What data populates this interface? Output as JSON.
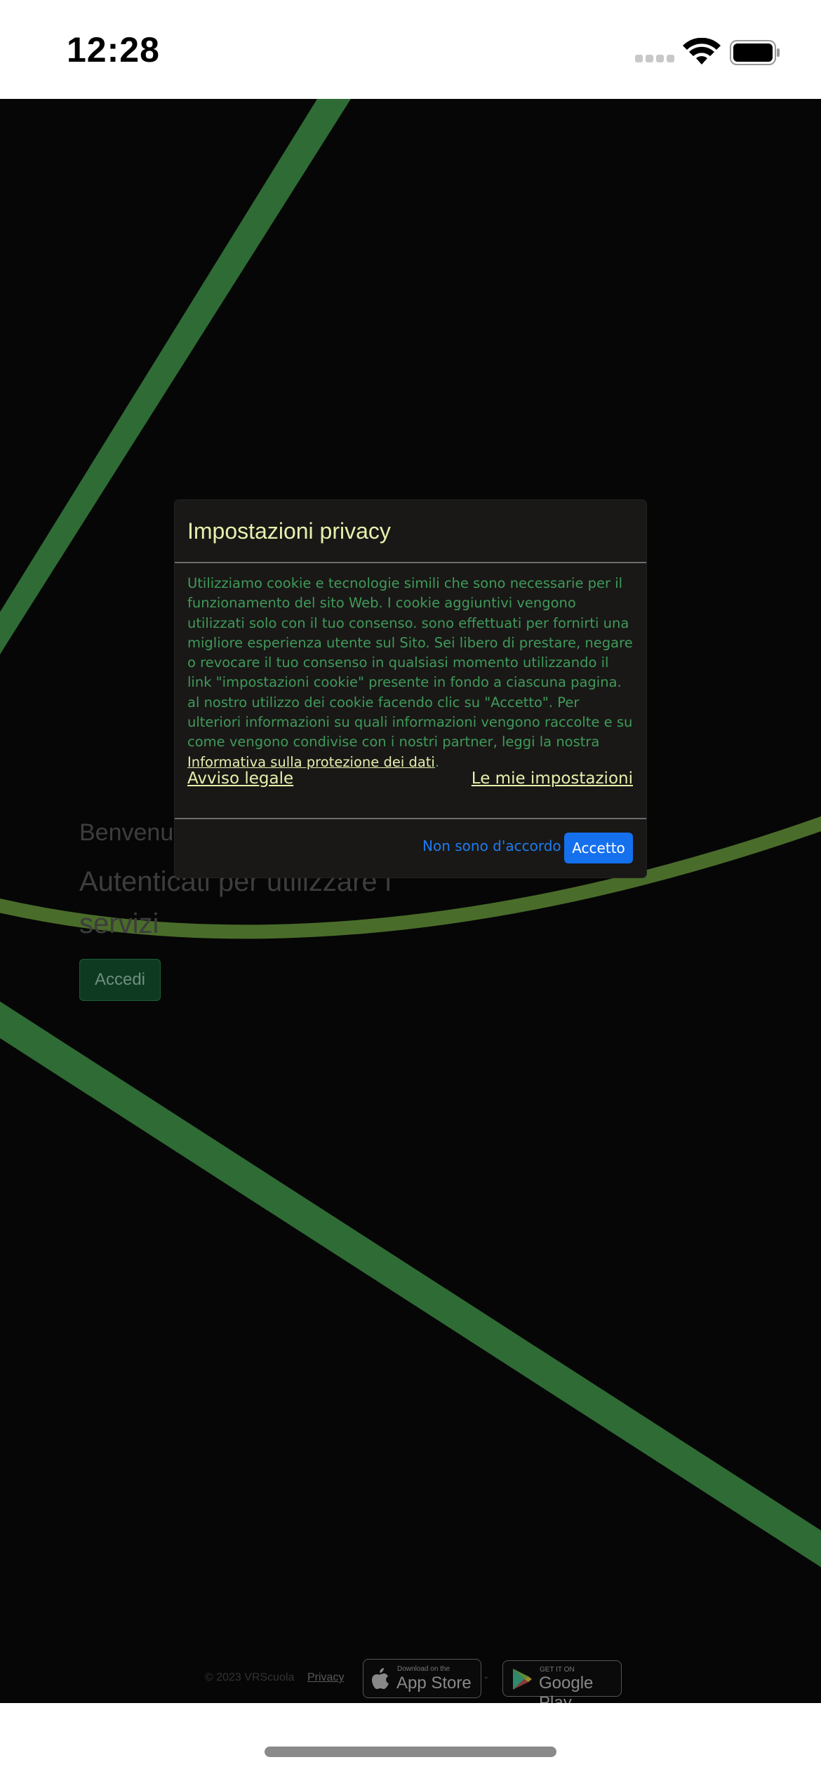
{
  "status_bar": {
    "time": "12:28"
  },
  "page": {
    "welcome": "Benvenuti nel sito VrScuola",
    "auth_prompt": "Autenticati per utilizzare i servizi",
    "login_button": "Accedi"
  },
  "footer": {
    "copyright": "© 2023 VRScuola",
    "privacy_link": "Privacy",
    "separator": "-",
    "app_store": {
      "small": "Download on the",
      "big": "App Store"
    },
    "google_play": {
      "small": "GET IT ON",
      "big": "Google Play"
    }
  },
  "privacy_modal": {
    "title": "Impostazioni privacy",
    "body": "Utilizziamo cookie e tecnologie simili che sono necessarie per il funzionamento del sito Web. I cookie aggiuntivi vengono utilizzati solo con il tuo consenso. sono effettuati per fornirti una migliore esperienza utente sul Sito. Sei libero di prestare, negare o revocare il tuo consenso in qualsiasi momento utilizzando il link \"impostazioni cookie\" presente in fondo a ciascuna pagina. al nostro utilizzo dei cookie facendo clic su \"Accetto\". Per ulteriori informazioni su quali informazioni vengono raccolte e su come vengono condivise con i nostri partner, leggi la nostra",
    "policy_link": "Informativa sulla protezione dei dati",
    "period": ".",
    "legal_link": "Avviso legale",
    "settings_link": "Le mie impostazioni",
    "decline_button": "Non sono d'accordo",
    "accept_button": "Accetto"
  },
  "colors": {
    "accent_blue": "#1570ee",
    "modal_title": "#e7f0ad",
    "modal_text": "#3f9a5a",
    "line_green": "#2f6b35"
  }
}
